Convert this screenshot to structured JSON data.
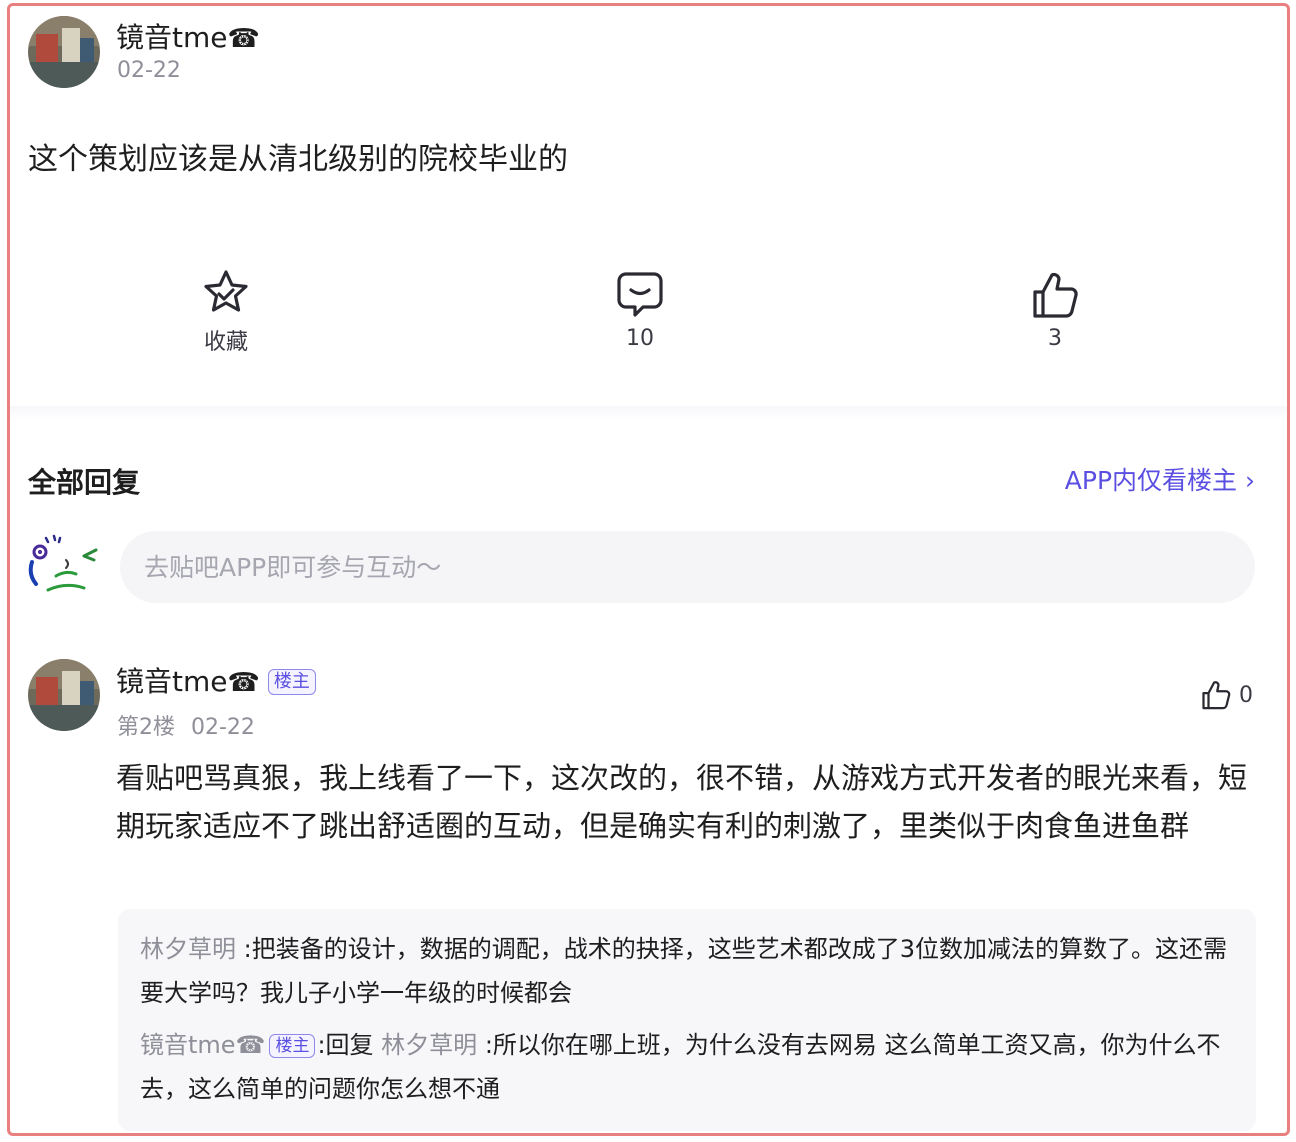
{
  "post": {
    "author": "镜音tme",
    "author_icon": "☎",
    "date": "02-22",
    "text": "这个策划应该是从清北级别的院校毕业的",
    "actions": {
      "favorite_label": "收藏",
      "comment_count": "10",
      "like_count": "3"
    }
  },
  "replies_section": {
    "title": "全部回复",
    "op_only_link": "APP内仅看楼主 ›",
    "input_placeholder": "去贴吧APP即可参与互动～"
  },
  "comment": {
    "author": "镜音tme",
    "author_icon": "☎",
    "badge": "楼主",
    "floor": "第2楼",
    "date": "02-22",
    "like_count": "0",
    "text": "看贴吧骂真狠，我上线看了一下，这次改的，很不错，从游戏方式开发者的眼光来看，短期玩家适应不了跳出舒适圈的互动，但是确实有利的刺激了，里类似于肉食鱼进鱼群",
    "sub_replies": [
      {
        "author": "林夕草明 ",
        "text": ":把装备的设计，数据的调配，战术的抉择，这些艺术都改成了3位数加减法的算数了。这还需要大学吗？我儿子小学一年级的时候都会"
      },
      {
        "author": "镜音tme☎",
        "badge": "楼主",
        "reply_prefix": ":回复 ",
        "reply_to": "林夕草明 ",
        "text": ":所以你在哪上班，为什么没有去网易 这么简单工资又高，你为什么不去，这么简单的问题你怎么想不通"
      }
    ]
  },
  "colors": {
    "accent": "#5a4fe0",
    "frame_border": "#e8807f",
    "muted_text": "#8f8f99"
  }
}
